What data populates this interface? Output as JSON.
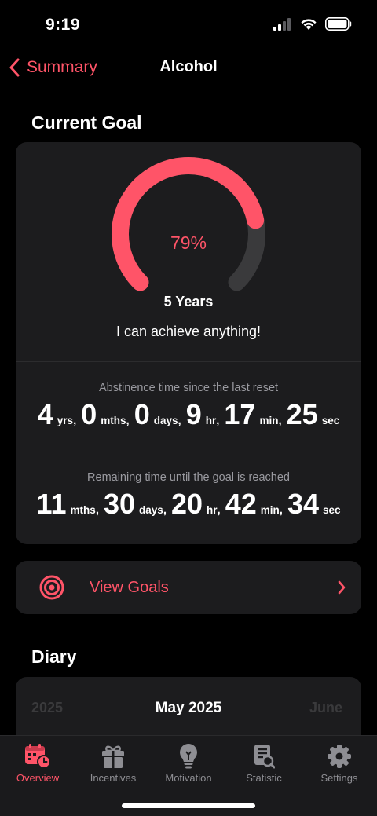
{
  "status": {
    "time": "9:19"
  },
  "nav": {
    "back_label": "Summary",
    "title": "Alcohol"
  },
  "current_goal": {
    "section_title": "Current Goal",
    "progress_percent_label": "79%",
    "progress_fraction": 0.79,
    "duration": "5 Years",
    "motto": "I can achieve anything!",
    "abstinence": {
      "caption": "Abstinence time since the last reset",
      "parts": [
        {
          "value": "4",
          "unit": "yrs",
          "sep": ","
        },
        {
          "value": "0",
          "unit": "mths",
          "sep": ","
        },
        {
          "value": "0",
          "unit": "days",
          "sep": ","
        },
        {
          "value": "9",
          "unit": "hr",
          "sep": ","
        },
        {
          "value": "17",
          "unit": "min",
          "sep": ","
        },
        {
          "value": "25",
          "unit": "sec",
          "sep": ""
        }
      ]
    },
    "remaining": {
      "caption": "Remaining time until the goal is reached",
      "parts": [
        {
          "value": "11",
          "unit": "mths",
          "sep": ","
        },
        {
          "value": "30",
          "unit": "days",
          "sep": ","
        },
        {
          "value": "20",
          "unit": "hr",
          "sep": ","
        },
        {
          "value": "42",
          "unit": "min",
          "sep": ","
        },
        {
          "value": "34",
          "unit": "sec",
          "sep": ""
        }
      ]
    }
  },
  "view_goals": {
    "label": "View Goals",
    "icon": "target-icon"
  },
  "diary": {
    "section_title": "Diary",
    "prev_label": "2025",
    "current_label": "May 2025",
    "next_label": "June"
  },
  "tabs": [
    {
      "label": "Overview",
      "icon": "calendar-clock-icon",
      "active": true
    },
    {
      "label": "Incentives",
      "icon": "gift-icon",
      "active": false
    },
    {
      "label": "Motivation",
      "icon": "lightbulb-icon",
      "active": false
    },
    {
      "label": "Statistic",
      "icon": "document-search-icon",
      "active": false
    },
    {
      "label": "Settings",
      "icon": "gear-icon",
      "active": false
    }
  ],
  "colors": {
    "accent": "#ff5468",
    "background": "#000000",
    "card": "#1c1c1e",
    "gauge_track": "#3a3a3c",
    "muted_text": "#9a9aa0"
  }
}
